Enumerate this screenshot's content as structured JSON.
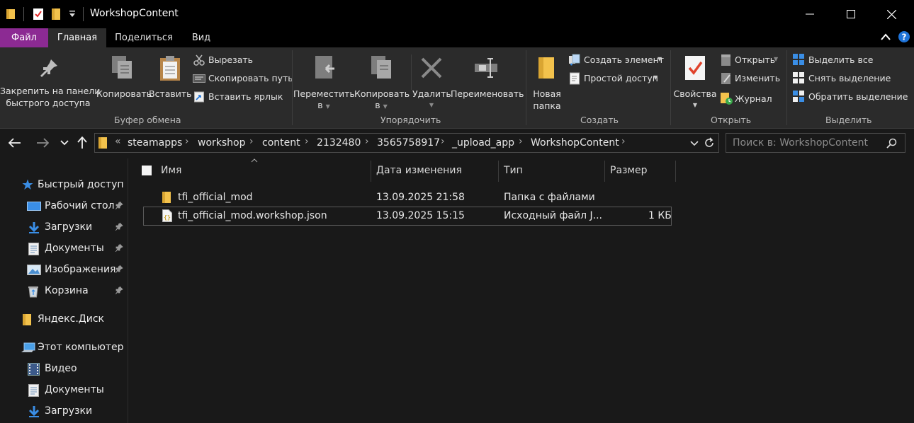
{
  "window": {
    "title": "WorkshopContent",
    "controls": [
      "minimize",
      "maximize",
      "close"
    ]
  },
  "ribbon_tabs": [
    "Файл",
    "Главная",
    "Поделиться",
    "Вид"
  ],
  "ribbon": {
    "clipboard": {
      "pin_label_1": "Закрепить на панели",
      "pin_label_2": "быстрого доступа",
      "copy": "Копировать",
      "paste": "Вставить",
      "cut": "Вырезать",
      "copy_path": "Скопировать путь",
      "paste_shortcut": "Вставить ярлык",
      "group": "Буфер обмена"
    },
    "organize": {
      "move_1": "Переместить",
      "move_2": "в",
      "copy_1": "Копировать",
      "copy_2": "в",
      "delete": "Удалить",
      "rename": "Переименовать",
      "group": "Упорядочить"
    },
    "create": {
      "new_folder_1": "Новая",
      "new_folder_2": "папка",
      "new_item": "Создать элемент",
      "easy_access": "Простой доступ",
      "group": "Создать"
    },
    "open": {
      "properties": "Свойства",
      "open": "Открыть",
      "edit": "Изменить",
      "history": "Журнал",
      "group": "Открыть"
    },
    "select": {
      "select_all": "Выделить все",
      "select_none": "Снять выделение",
      "invert": "Обратить выделение",
      "group": "Выделить"
    }
  },
  "address": {
    "overflow": "«",
    "crumbs": [
      "steamapps",
      "workshop",
      "content",
      "2132480",
      "3565758917",
      "_upload_app",
      "WorkshopContent"
    ],
    "search_placeholder": "Поиск в: WorkshopContent"
  },
  "nav": {
    "quick_access": "Быстрый доступ",
    "qa_items": [
      "Рабочий стол",
      "Загрузки",
      "Документы",
      "Изображения",
      "Корзина"
    ],
    "yandex": "Яндекс.Диск",
    "this_pc": "Этот компьютер",
    "pc_items": [
      "Видео",
      "Документы",
      "Загрузки"
    ]
  },
  "columns": {
    "name": "Имя",
    "date": "Дата изменения",
    "type": "Тип",
    "size": "Размер"
  },
  "files": [
    {
      "name": "tfi_official_mod",
      "date": "13.09.2025 21:58",
      "type": "Папка с файлами",
      "size": "",
      "icon": "folder-icon",
      "selected": false
    },
    {
      "name": "tfi_official_mod.workshop.json",
      "date": "13.09.2025 15:15",
      "type": "Исходный файл J...",
      "size": "1 КБ",
      "icon": "json-file-icon",
      "selected": true
    }
  ],
  "colors": {
    "file_tab": "#8c2a93",
    "folder": "#f3c24c",
    "accent_blue": "#3a8ee6",
    "background": "#191919",
    "ribbon": "#2b2b2b"
  }
}
